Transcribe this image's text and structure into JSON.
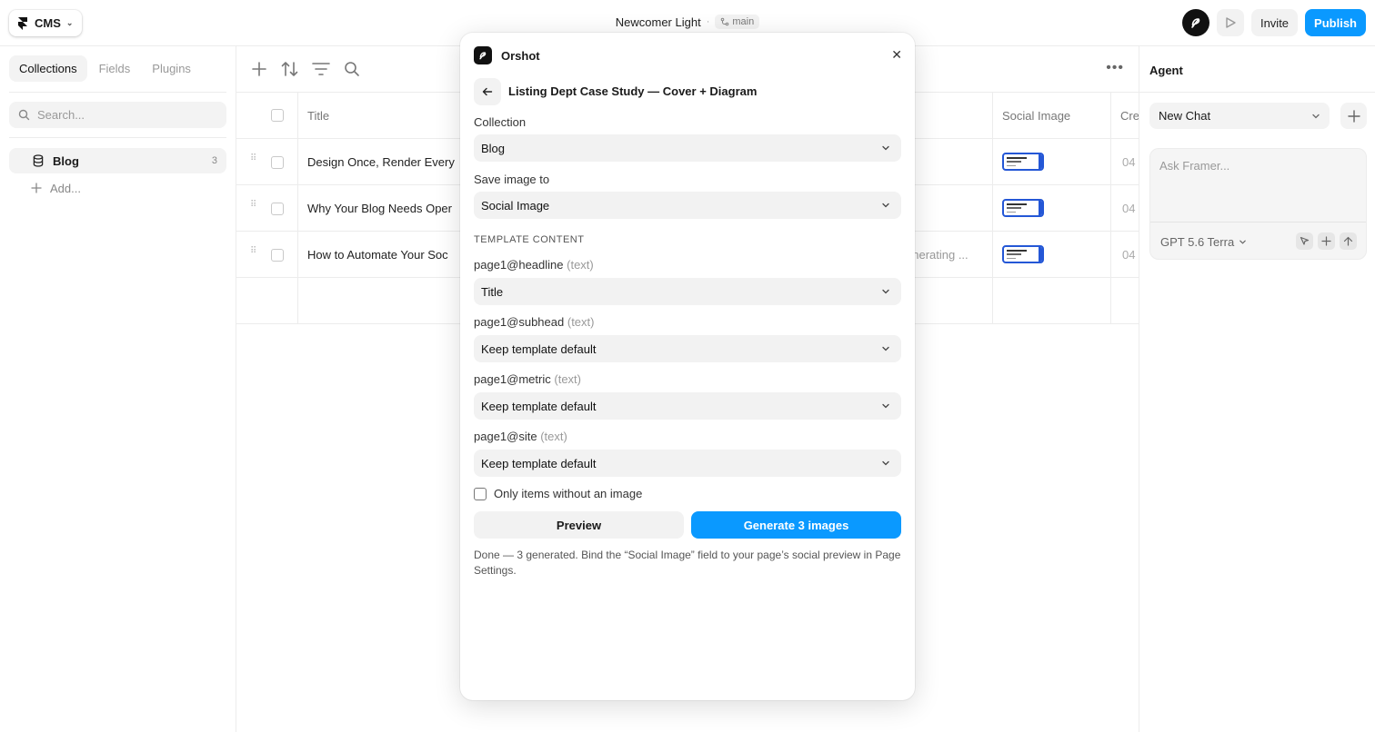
{
  "topbar": {
    "cms_label": "CMS",
    "project_name": "Newcomer Light",
    "separator": "·",
    "branch": "main",
    "invite_label": "Invite",
    "publish_label": "Publish",
    "accent": "#0a99ff"
  },
  "sidebar": {
    "tabs": [
      {
        "label": "Collections",
        "active": true
      },
      {
        "label": "Fields",
        "active": false
      },
      {
        "label": "Plugins",
        "active": false
      }
    ],
    "search_placeholder": "Search...",
    "collections": [
      {
        "label": "Blog",
        "count": "3"
      }
    ],
    "add_label": "Add..."
  },
  "table": {
    "columns": {
      "title": "Title",
      "social_image": "Social Image",
      "created": "Cre"
    },
    "rows": [
      {
        "title": "Design Once, Render Every",
        "status": "",
        "date": "04"
      },
      {
        "title": "Why Your Blog Needs Oper",
        "status": "",
        "date": "04"
      },
      {
        "title": "How to Automate Your Soc",
        "status": "enerating ...",
        "date": "04"
      }
    ]
  },
  "agent": {
    "title": "Agent",
    "chat_select": "New Chat",
    "ask_placeholder": "Ask Framer...",
    "model": "GPT 5.6 Terra"
  },
  "modal": {
    "plugin_name": "Orshot",
    "template_title": "Listing Dept Case Study — Cover + Diagram",
    "collection_label": "Collection",
    "collection_value": "Blog",
    "save_label": "Save image to",
    "save_value": "Social Image",
    "section_title": "TEMPLATE CONTENT",
    "fields": [
      {
        "name": "page1@headline",
        "type": "(text)",
        "value": "Title"
      },
      {
        "name": "page1@subhead",
        "type": "(text)",
        "value": "Keep template default"
      },
      {
        "name": "page1@metric",
        "type": "(text)",
        "value": "Keep template default"
      },
      {
        "name": "page1@site",
        "type": "(text)",
        "value": "Keep template default"
      }
    ],
    "only_without_image_label": "Only items without an image",
    "preview_label": "Preview",
    "generate_label": "Generate 3 images",
    "done_message": "Done — 3 generated. Bind the “Social Image” field to your page’s social preview in Page Settings."
  }
}
